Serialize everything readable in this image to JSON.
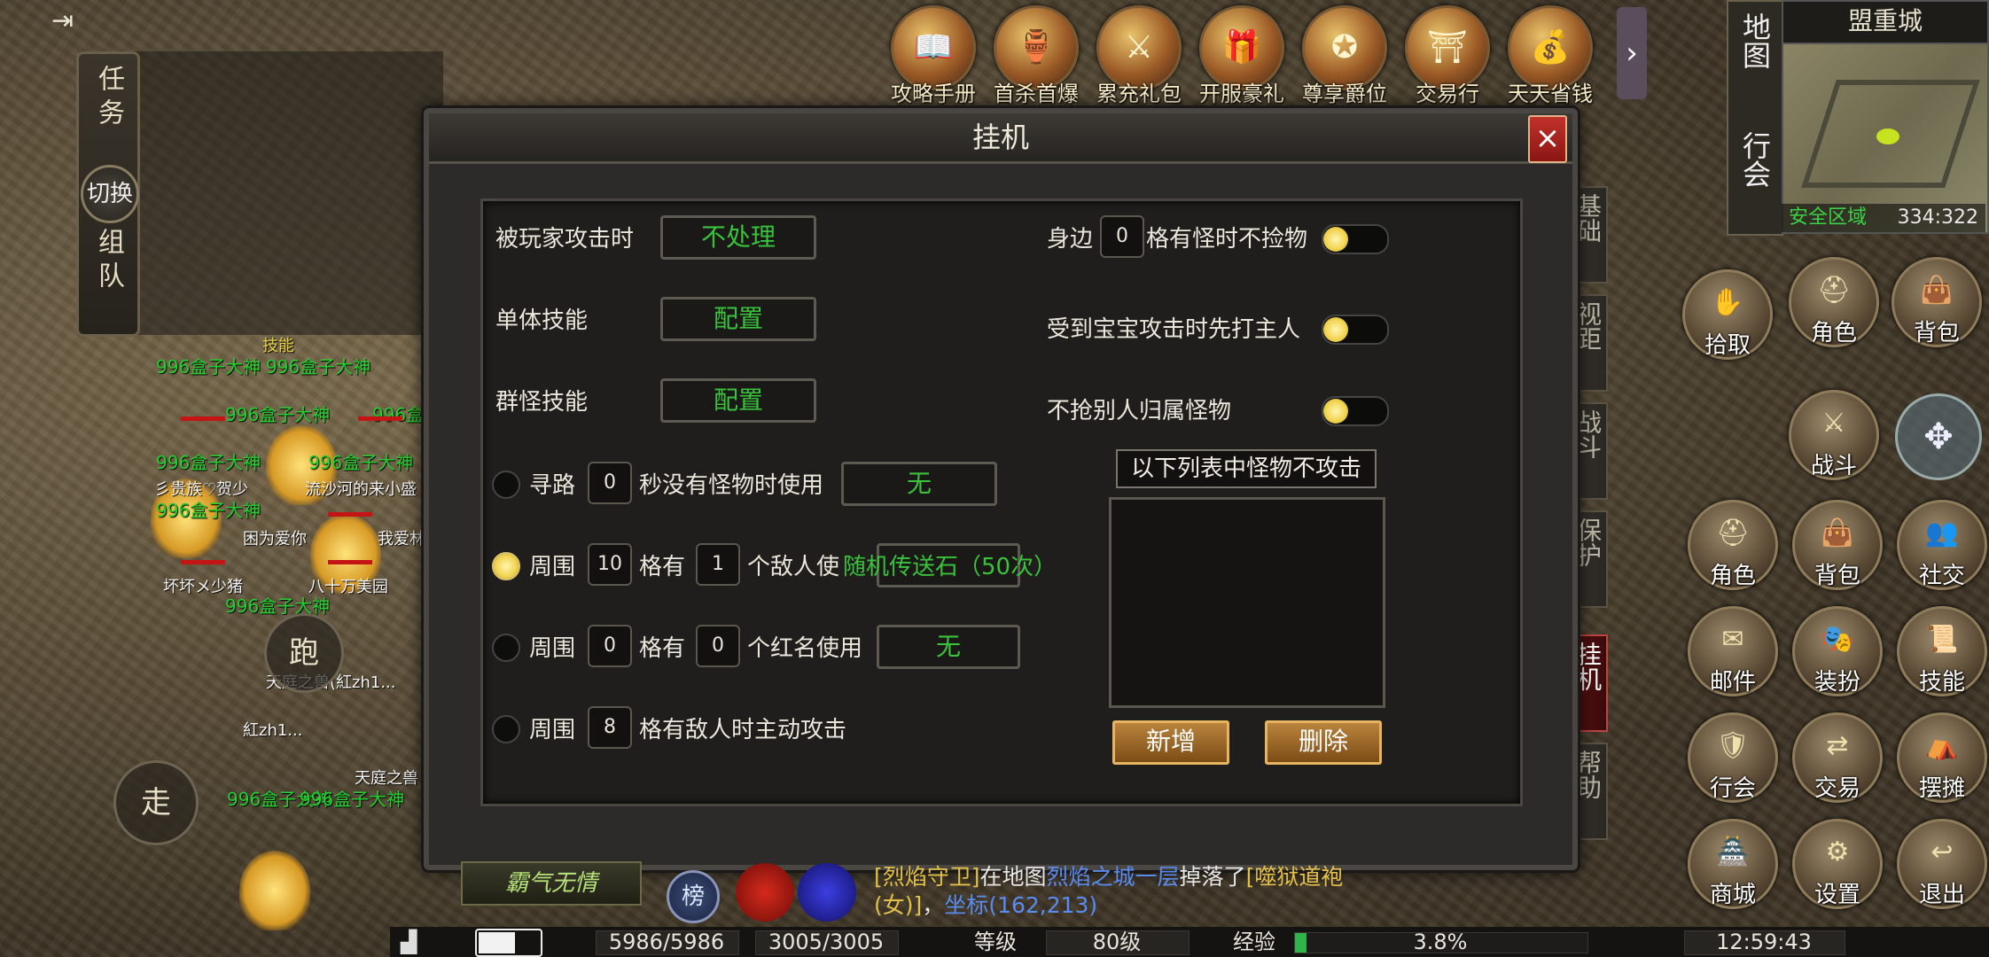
{
  "top_shortcuts": [
    {
      "label": "攻略手册",
      "icon": "book-icon"
    },
    {
      "label": "首杀首爆",
      "icon": "treasure-bowl-icon"
    },
    {
      "label": "累充礼包",
      "icon": "gift-warrior-icon"
    },
    {
      "label": "开服豪礼",
      "icon": "gift-box-icon"
    },
    {
      "label": "尊享爵位",
      "icon": "noble-medal-icon"
    },
    {
      "label": "交易行",
      "icon": "pagoda-icon"
    },
    {
      "label": "天天省钱",
      "icon": "gold-ingot-icon"
    }
  ],
  "top_arrow": "›",
  "side_menu": {
    "task": "任务",
    "switch": "切换",
    "team": "组队"
  },
  "minimap": {
    "map_name": "盟重城",
    "map_button": "地图",
    "guild_button": "行会",
    "zone": "安全区域",
    "coords": "334:322"
  },
  "dialog": {
    "title": "挂机",
    "close": "×",
    "player_attack_label": "被玩家攻击时",
    "player_attack_value": "不处理",
    "single_skill_label": "单体技能",
    "single_skill_value": "配置",
    "group_skill_label": "群怪技能",
    "group_skill_value": "配置",
    "row_path": {
      "pre": "寻路",
      "num": "0",
      "mid": "秒没有怪物时使用",
      "value": "无"
    },
    "row_enemy": {
      "pre": "周围",
      "num1": "10",
      "mid1": "格有",
      "num2": "1",
      "mid2": "个敌人使",
      "value": "随机传送石（50次）"
    },
    "row_red": {
      "pre": "周围",
      "num1": "0",
      "mid1": "格有",
      "num2": "0",
      "mid2": "个红名使用",
      "value": "无"
    },
    "row_attack": {
      "pre": "周围",
      "num": "8",
      "post": "格有敌人时主动攻击"
    },
    "nearby": {
      "pre": "身边",
      "num": "0",
      "post": "格有怪时不捡物"
    },
    "pet_attack": "受到宝宝攻击时先打主人",
    "no_steal": "不抢别人归属怪物",
    "list_header": "以下列表中怪物不攻击",
    "add": "新增",
    "delete": "删除"
  },
  "tabs": [
    "基础",
    "视距",
    "战斗",
    "保护",
    "挂机",
    "帮助"
  ],
  "active_tab": "挂机",
  "right_buttons": [
    {
      "label": "拾取",
      "icon": "pickup-icon"
    },
    {
      "label": "角色",
      "icon": "helmet-icon"
    },
    {
      "label": "背包",
      "icon": "bag-icon"
    },
    {
      "label": "战斗",
      "icon": "crossed-swords-icon"
    },
    {
      "label": "角色",
      "icon": "helmet-icon"
    },
    {
      "label": "背包",
      "icon": "bag-icon"
    },
    {
      "label": "社交",
      "icon": "people-icon"
    },
    {
      "label": "邮件",
      "icon": "mail-icon"
    },
    {
      "label": "装扮",
      "icon": "costume-icon"
    },
    {
      "label": "技能",
      "icon": "skill-book-icon"
    },
    {
      "label": "行会",
      "icon": "guild-icon"
    },
    {
      "label": "交易",
      "icon": "trade-icon"
    },
    {
      "label": "摆摊",
      "icon": "stall-icon"
    },
    {
      "label": "商城",
      "icon": "shop-icon"
    },
    {
      "label": "设置",
      "icon": "gear-icon"
    },
    {
      "label": "退出",
      "icon": "exit-arrow-icon"
    }
  ],
  "world_tags": {
    "guild_name": "996盒子大神",
    "names": [
      "彡贵族♡贺少",
      "流沙河的来小盛",
      "困为爱你",
      "我爱林",
      "坏坏メ少猪",
      "八十万美园",
      "天庭之兽(紅zh1...",
      "紅zh1...",
      "天庭之兽"
    ],
    "skill_label": "技能",
    "run": "跑",
    "walk": "走"
  },
  "chat": {
    "npc": "[烈焰守卫]",
    "t1": "在地图",
    "map": "烈焰之城一层",
    "t2": "掉落了",
    "item": "[噬狱道袍(女)]",
    "t3": "，",
    "coord": "坐标(162,213)"
  },
  "bottom": {
    "hp": "5986/5986",
    "mp": "3005/3005",
    "level_label": "等级",
    "level": "80级",
    "exp_label": "经验",
    "exp": "3.8%",
    "time": "12:59:43",
    "battery_pct": 0.6,
    "exp_frac": 0.038
  },
  "bottom_left_button": "霸气无情",
  "rank_button": "榜"
}
